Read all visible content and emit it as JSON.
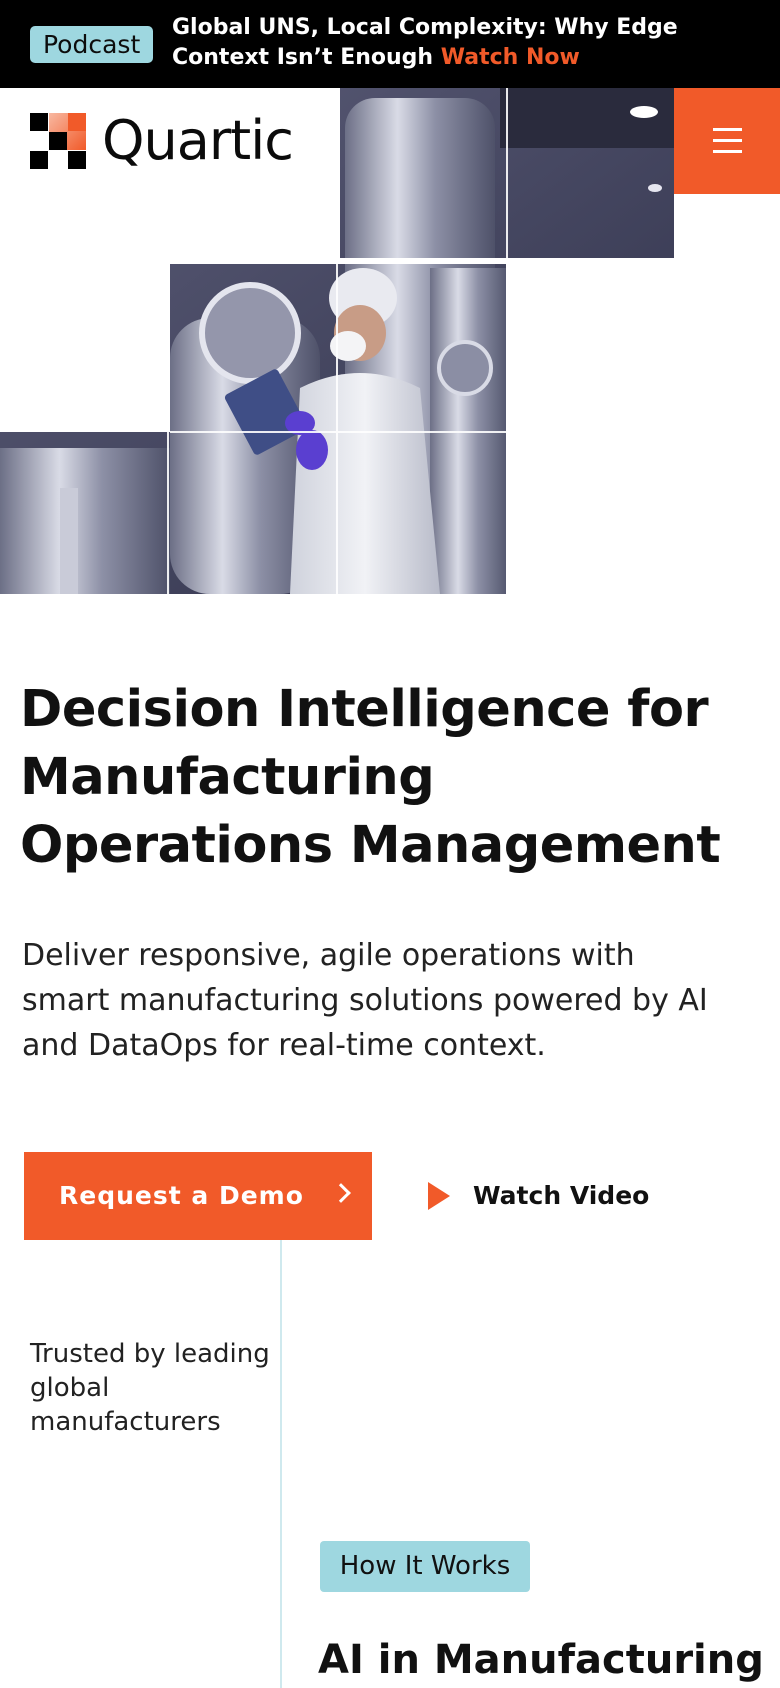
{
  "banner": {
    "badge": "Podcast",
    "text": "Global UNS, Local Complexity: Why Edge Context Isn’t Enough ",
    "cta": "Watch Now"
  },
  "header": {
    "logo_text": "Quartic",
    "menu_icon": "hamburger-menu-icon"
  },
  "hero": {
    "image_alt": "Worker in protective gear using a tablet beside stainless steel tanks",
    "headline": "Decision Intelligence for Manufacturing Operations Management",
    "subtext": "Deliver responsive, agile operations with smart manufacturing solutions powered by AI and DataOps for real-time context.",
    "primary_cta": "Request a Demo",
    "primary_cta_icon": "chevron-right-icon",
    "secondary_cta": "Watch Video",
    "secondary_cta_icon": "play-icon"
  },
  "trusted": {
    "text": "Trusted by leading global manufacturers"
  },
  "how_it_works": {
    "badge": "How It Works",
    "title": "AI in Manufacturing"
  },
  "colors": {
    "accent": "#f15a29",
    "badge_bg": "#9ed7e0",
    "banner_bg": "#000000"
  }
}
